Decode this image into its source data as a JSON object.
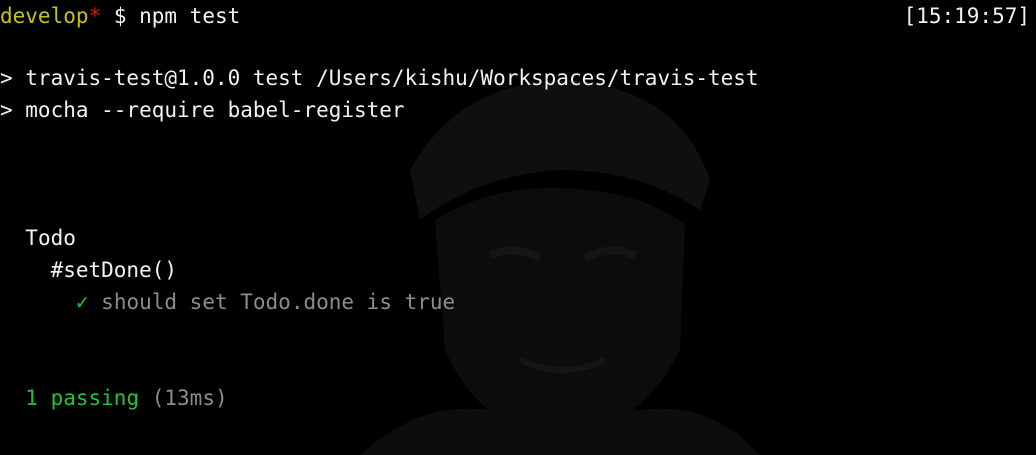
{
  "prompt": {
    "branch": "develop",
    "dirty_marker": "*",
    "separator": " $ ",
    "command": "npm test",
    "time": "[15:19:57]"
  },
  "npm_output": {
    "line1": "> travis-test@1.0.0 test /Users/kishu/Workspaces/travis-test",
    "line2": "> mocha --require babel-register"
  },
  "tests": {
    "suite": "Todo",
    "describe": "#setDone()",
    "check_mark": "✓",
    "case": "should set Todo.done is true"
  },
  "summary": {
    "passing": "1 passing",
    "duration": "(13ms)"
  },
  "colors": {
    "background": "#000000",
    "foreground": "#f2f2f2",
    "branch": "#c2c224",
    "dirty": "#d41a1a",
    "pass": "#23c239",
    "dim": "#8c8c8c"
  },
  "icons": {
    "background": "portrait-silhouette-icon",
    "test_pass": "check-mark-icon"
  }
}
